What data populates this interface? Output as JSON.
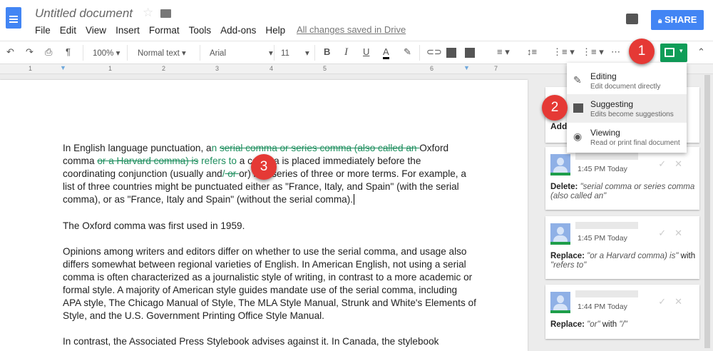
{
  "header": {
    "title": "Untitled document",
    "menus": [
      "File",
      "Edit",
      "View",
      "Insert",
      "Format",
      "Tools",
      "Add-ons",
      "Help"
    ],
    "save_status": "All changes saved in Drive",
    "share_label": "SHARE",
    "share_color": "#4285f4"
  },
  "toolbar": {
    "zoom": "100%",
    "style": "Normal text",
    "font": "Arial",
    "size": "11",
    "bold": "B",
    "italic": "I",
    "underline": "U",
    "text_color": "A",
    "more": "⋯",
    "mode_color": "#0f9d58"
  },
  "ruler": [
    "1",
    "1",
    "2",
    "3",
    "4",
    "5",
    "6",
    "7"
  ],
  "mode_menu": [
    {
      "title": "Editing",
      "subtitle": "Edit document directly",
      "icon": "pencil-icon"
    },
    {
      "title": "Suggesting",
      "subtitle": "Edits become suggestions",
      "icon": "suggest-icon"
    },
    {
      "title": "Viewing",
      "subtitle": "Read or print final document",
      "icon": "eye-icon"
    }
  ],
  "badges": [
    "1",
    "2",
    "3"
  ],
  "doc": {
    "p1": {
      "a": "In English language punctuation, a",
      "b": "n",
      "del1": "serial comma or series comma (also called an ",
      "c": "Oxford comma ",
      "del2": "or a Harvard comma) is",
      "ins2": " refers to",
      "d": "a co",
      "e": "mma is placed immediately before the coordinating conjunction (usually and",
      "ins3": "/",
      "del3": " or ",
      "f": "or) in a series of three or more terms. For example, a list of three countries might be punctuated either as \"France, Italy, and Spain\" (with the serial comma), or as \"France, Italy and Spain\" (without the serial comma)."
    },
    "p2": "The Oxford comma was first used in 1959.",
    "p3": "Opinions among writers and editors differ on whether to use the serial comma, and usage also differs somewhat between regional varieties of English. In American English, not using a serial comma is often characterized as a journalistic style of writing, in contrast to a more academic or formal style. A majority of American style guides mandate use of the serial comma, including APA style, The Chicago Manual of Style, The MLA Style Manual, Strunk and White's Elements of Style, and the U.S. Government Printing Office Style Manual.",
    "p4": "In contrast, the Associated Press Stylebook advises against it. In Canada, the stylebook"
  },
  "comments": {
    "partial_label": "Add",
    "items": [
      {
        "time": "1:45 PM Today",
        "action": "Delete:",
        "quote1": "\"serial comma or series comma (also called an\"",
        "with": "",
        "quote2": ""
      },
      {
        "time": "1:45 PM Today",
        "action": "Replace:",
        "quote1": "\"or a Harvard comma) is\"",
        "with": " with ",
        "quote2": "\"refers to\""
      },
      {
        "time": "1:44 PM Today",
        "action": "Replace:",
        "quote1": "\"or\"",
        "with": " with ",
        "quote2": "\"/\""
      }
    ]
  }
}
